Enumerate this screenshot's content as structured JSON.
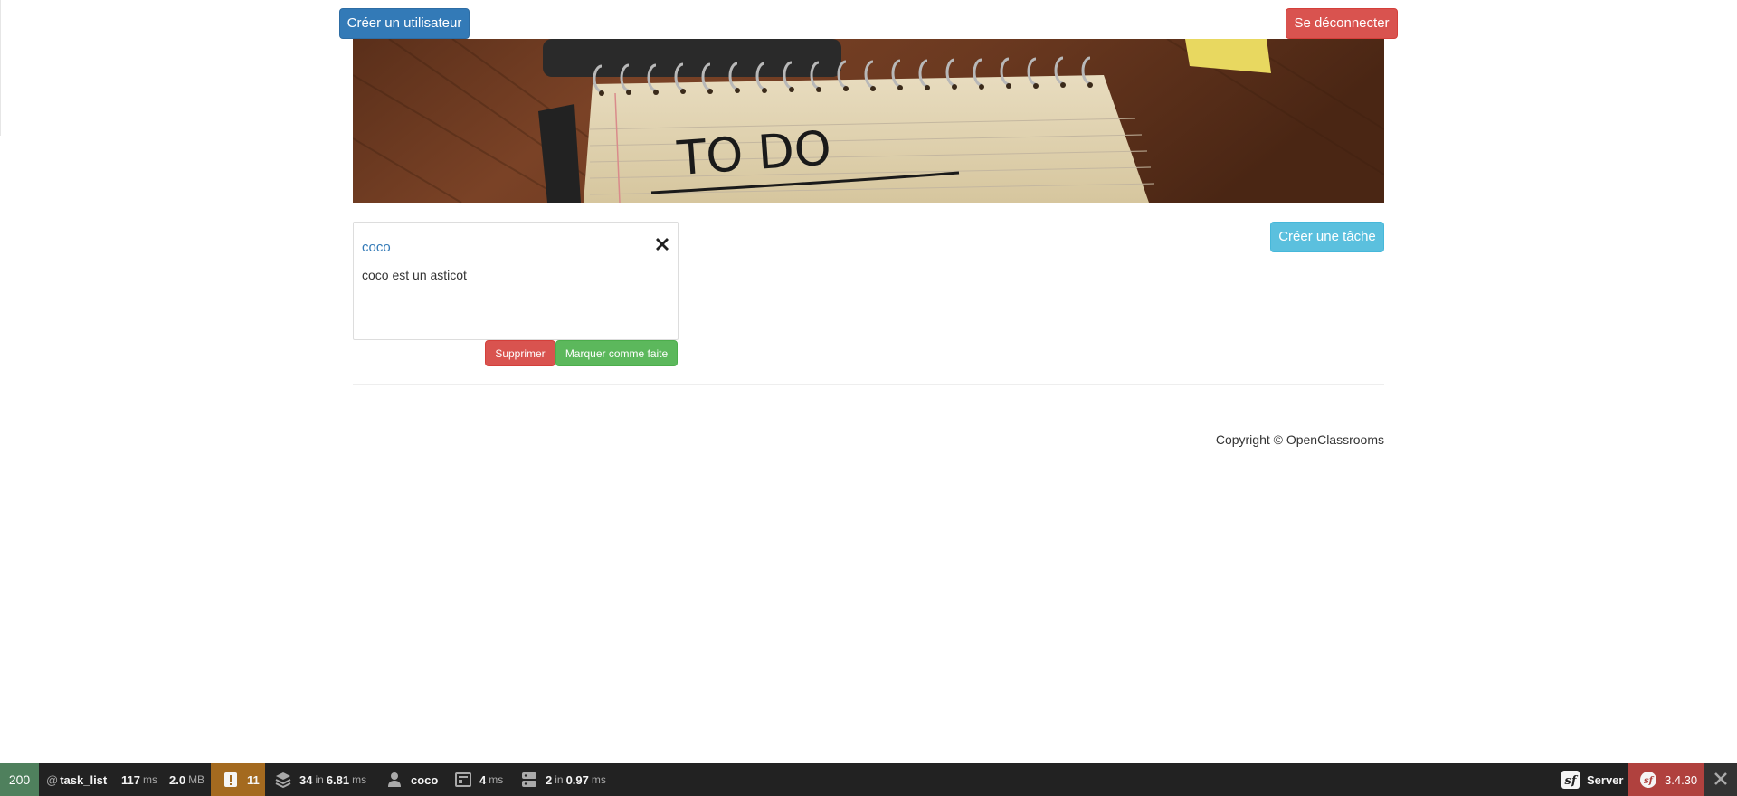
{
  "header": {
    "create_user_label": "Créer un utilisateur",
    "logout_label": "Se déconnecter"
  },
  "banner": {
    "note_text": "TO DO"
  },
  "actions": {
    "create_task_label": "Créer une tâche"
  },
  "tasks": [
    {
      "title": "coco",
      "content": "coco est un asticot",
      "status_icon": "remove-icon",
      "delete_label": "Supprimer",
      "toggle_label": "Marquer comme faite"
    }
  ],
  "footer": {
    "copyright": "Copyright © OpenClassrooms"
  },
  "debug_toolbar": {
    "status_code": "200",
    "route_prefix": "@",
    "route": "task_list",
    "time_value": "117",
    "time_unit": "ms",
    "memory_value": "2.0",
    "memory_unit": "MB",
    "warnings_count": "11",
    "db_queries": "34",
    "db_in": "in",
    "db_time": "6.81",
    "db_unit": "ms",
    "user": "coco",
    "twig_time": "4",
    "twig_unit": "ms",
    "cache_calls": "2",
    "cache_in": "in",
    "cache_time": "0.97",
    "cache_unit": "ms",
    "server_label": "Server",
    "symfony_version": "3.4.30"
  },
  "colors": {
    "primary": "#337ab7",
    "danger": "#d9534f",
    "info": "#5bc0de",
    "success": "#5cb85c",
    "toolbar_bg": "#222222",
    "status_ok": "#4f805d",
    "warning": "#a46a1f",
    "version_bg": "#b0413e"
  }
}
